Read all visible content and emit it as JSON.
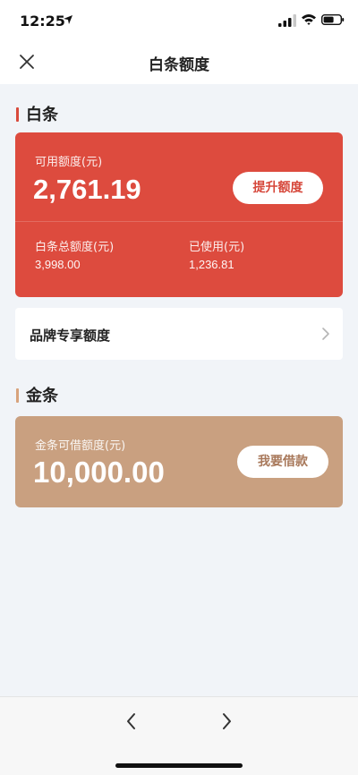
{
  "status_bar": {
    "time": "12:25"
  },
  "nav": {
    "title": "白条额度"
  },
  "baitiao": {
    "section_title": "白条",
    "available_label": "可用额度(元)",
    "available_value": "2,761.19",
    "raise_button": "提升额度",
    "total_label": "白条总额度(元)",
    "total_value": "3,998.00",
    "used_label": "已使用(元)",
    "used_value": "1,236.81"
  },
  "brand": {
    "label": "品牌专享额度"
  },
  "jintiao": {
    "section_title": "金条",
    "borrowable_label": "金条可借额度(元)",
    "borrowable_value": "10,000.00",
    "borrow_button": "我要借款"
  },
  "colors": {
    "red": "#dd4b3e",
    "gold": "#c9a080",
    "baitiao_accent": "#d94a3c",
    "jintiao_accent": "#d8a37c"
  }
}
